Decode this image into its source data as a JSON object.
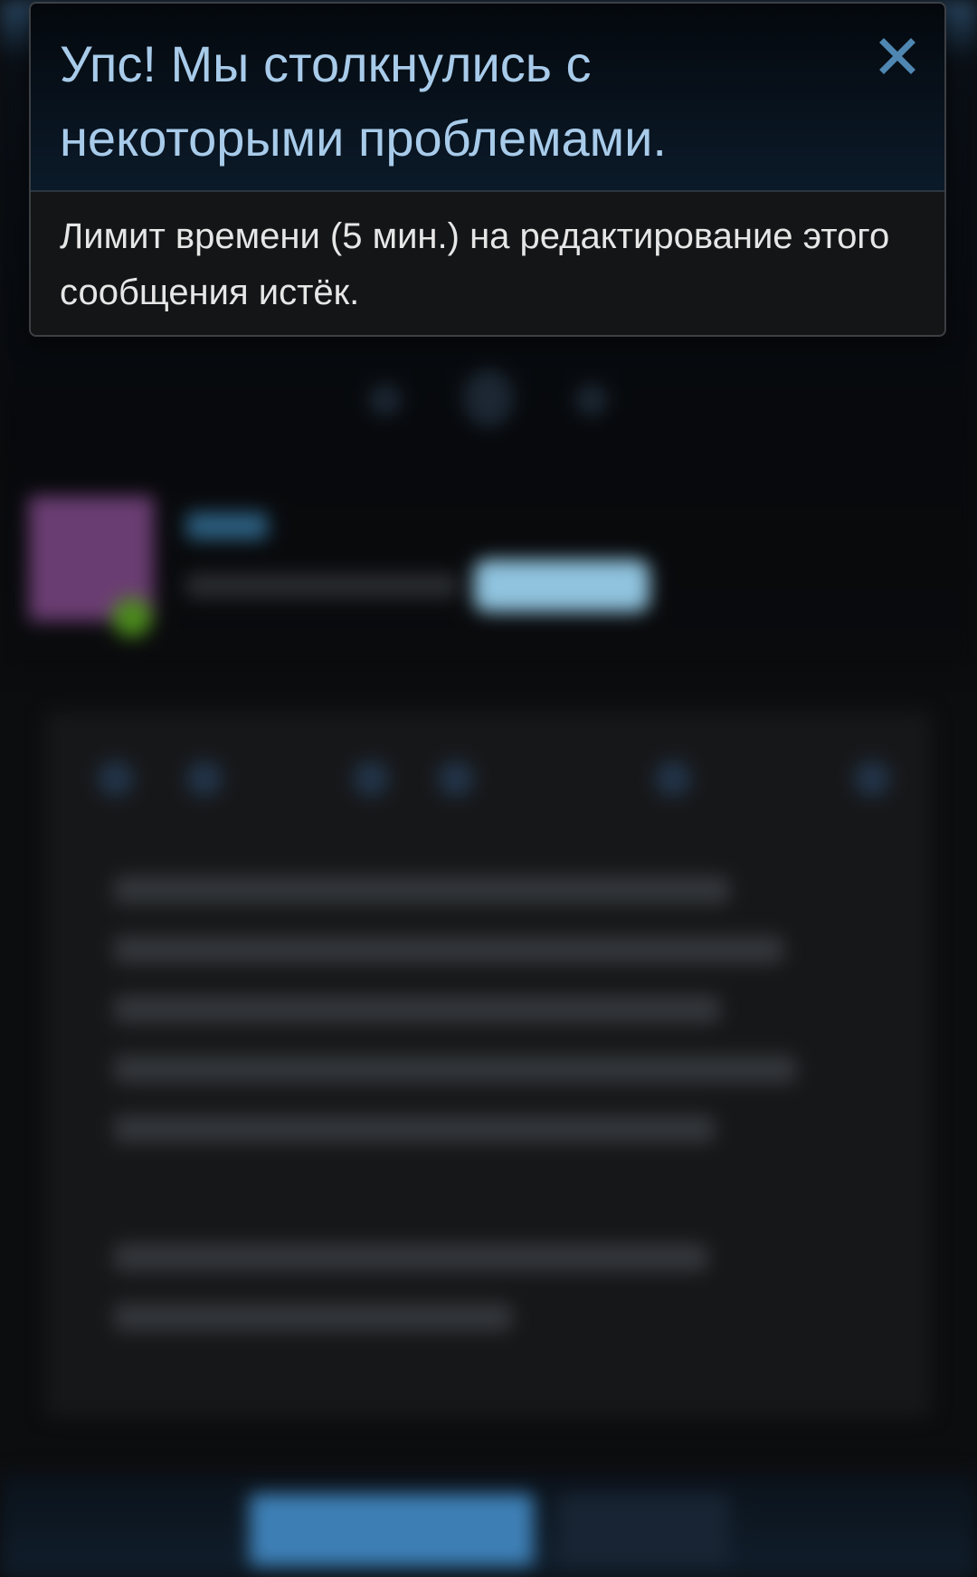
{
  "error_toast": {
    "title": "Упс! Мы столкнулись с некоторыми проблемами.",
    "message": "Лимит времени (5 мин.) на редактирование этого сообщения истёк.",
    "close_icon": "close-icon"
  },
  "colors": {
    "title": "#a8cbea",
    "close_icon": "#4f87b2",
    "message": "#e6e6e6"
  }
}
